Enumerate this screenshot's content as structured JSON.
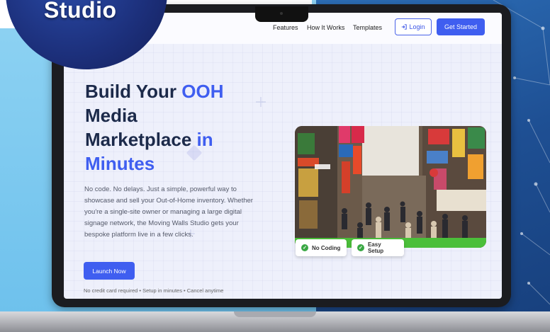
{
  "badge": {
    "text": "Studio"
  },
  "nav": {
    "links": [
      "Features",
      "How It Works",
      "Templates"
    ],
    "login_label": "Login",
    "get_started_label": "Get Started"
  },
  "hero": {
    "headline_part1": "Build Your",
    "headline_highlight1": "OOH",
    "headline_part2": "Media",
    "headline_part3": "Marketplace",
    "headline_highlight2": "in",
    "headline_highlight3": "Minutes",
    "description": "No code. No delays. Just a simple, powerful way to showcase and sell your Out-of-Home inventory. Whether you're a single-site owner or managing a large digital signage network, the Moving Walls Studio gets your bespoke platform live in a few clicks.",
    "launch_label": "Launch Now",
    "fine_print": "No credit card required  •  Setup in minutes  •  Cancel anytime"
  },
  "features": [
    "No Coding",
    "Easy Setup"
  ],
  "colors": {
    "accent": "#3f5ef0",
    "headline": "#1c2a4a",
    "success": "#3aa844",
    "badge": "#1c2f7a"
  },
  "icons": {
    "login": "login-icon",
    "check": "check-circle-icon"
  }
}
